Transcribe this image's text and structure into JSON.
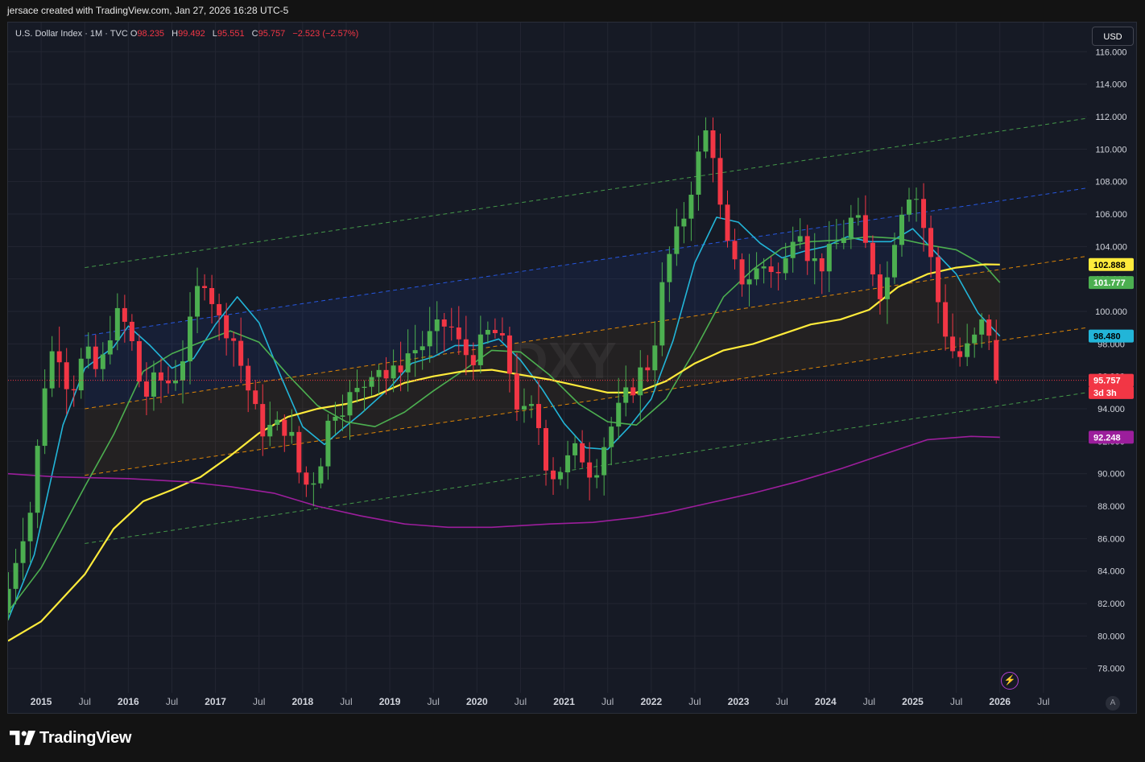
{
  "header": {
    "caption": "jersace created with TradingView.com, Jan 27, 2026 16:28 UTC-5"
  },
  "legend": {
    "symbol": "U.S. Dollar Index · 1M · TVC",
    "o_label": "O",
    "o_value": "98.235",
    "h_label": "H",
    "h_value": "99.492",
    "l_label": "L",
    "l_value": "95.551",
    "c_label": "C",
    "c_value": "95.757",
    "change": "−2.523 (−2.57%)"
  },
  "currency_button": "USD",
  "auto_scale_label": "A",
  "alert_icon": "lightning-bolt-icon",
  "watermark": "DXY",
  "brand": {
    "logo_icon": "tradingview-logo-icon",
    "name": "TradingView"
  },
  "colors": {
    "background": "#161a25",
    "up": "#4caf50",
    "down": "#f23645",
    "sma_short": "#22b5d8",
    "sma_mid": "#4caf50",
    "sma_long": "#ffeb3b",
    "sma_xlong": "#9c1e9c",
    "channel_orange": "#ff9800",
    "channel_blue": "#2962ff",
    "channel_green": "#4caf50"
  },
  "chart_data": {
    "type": "candlestick",
    "interval": "1M",
    "y_axis": {
      "range": [
        76.5,
        117.8
      ],
      "ticks": [
        "116.000",
        "114.000",
        "112.000",
        "110.000",
        "108.000",
        "106.000",
        "104.000",
        "102.000",
        "100.000",
        "98.000",
        "96.000",
        "94.000",
        "92.000",
        "90.000",
        "88.000",
        "86.000",
        "84.000",
        "82.000",
        "80.000",
        "78.000"
      ]
    },
    "x_axis": {
      "range": [
        2014.62,
        2027.0
      ],
      "ticks": [
        {
          "t": 2015.0,
          "label": "2015"
        },
        {
          "t": 2015.5,
          "label": "Jul"
        },
        {
          "t": 2016.0,
          "label": "2016"
        },
        {
          "t": 2016.5,
          "label": "Jul"
        },
        {
          "t": 2017.0,
          "label": "2017"
        },
        {
          "t": 2017.5,
          "label": "Jul"
        },
        {
          "t": 2018.0,
          "label": "2018"
        },
        {
          "t": 2018.5,
          "label": "Jul"
        },
        {
          "t": 2019.0,
          "label": "2019"
        },
        {
          "t": 2019.5,
          "label": "Jul"
        },
        {
          "t": 2020.0,
          "label": "2020"
        },
        {
          "t": 2020.5,
          "label": "Jul"
        },
        {
          "t": 2021.0,
          "label": "2021"
        },
        {
          "t": 2021.5,
          "label": "Jul"
        },
        {
          "t": 2022.0,
          "label": "2022"
        },
        {
          "t": 2022.5,
          "label": "Jul"
        },
        {
          "t": 2023.0,
          "label": "2023"
        },
        {
          "t": 2023.5,
          "label": "Jul"
        },
        {
          "t": 2024.0,
          "label": "2024"
        },
        {
          "t": 2024.5,
          "label": "Jul"
        },
        {
          "t": 2025.0,
          "label": "2025"
        },
        {
          "t": 2025.5,
          "label": "Jul"
        },
        {
          "t": 2026.0,
          "label": "2026"
        },
        {
          "t": 2026.5,
          "label": "Jul"
        }
      ]
    },
    "close_anchors": [
      [
        2014.62,
        82.8
      ],
      [
        2014.75,
        85.9
      ],
      [
        2014.92,
        88.4
      ],
      [
        2015.0,
        94.8
      ],
      [
        2015.17,
        98.4
      ],
      [
        2015.33,
        95.0
      ],
      [
        2015.5,
        97.4
      ],
      [
        2015.67,
        96.0
      ],
      [
        2015.83,
        99.8
      ],
      [
        2016.0,
        99.0
      ],
      [
        2016.17,
        94.6
      ],
      [
        2016.33,
        95.8
      ],
      [
        2016.5,
        95.6
      ],
      [
        2016.67,
        97.9
      ],
      [
        2016.83,
        102.2
      ],
      [
        2016.92,
        102.2
      ],
      [
        2017.0,
        99.5
      ],
      [
        2017.17,
        99.0
      ],
      [
        2017.33,
        96.0
      ],
      [
        2017.5,
        92.9
      ],
      [
        2017.67,
        92.7
      ],
      [
        2017.83,
        93.1
      ],
      [
        2018.0,
        89.1
      ],
      [
        2018.17,
        90.1
      ],
      [
        2018.33,
        94.0
      ],
      [
        2018.5,
        94.5
      ],
      [
        2018.67,
        95.1
      ],
      [
        2018.83,
        97.1
      ],
      [
        2019.0,
        95.6
      ],
      [
        2019.17,
        97.3
      ],
      [
        2019.33,
        97.8
      ],
      [
        2019.5,
        98.5
      ],
      [
        2019.67,
        99.4
      ],
      [
        2019.83,
        97.4
      ],
      [
        2020.0,
        97.4
      ],
      [
        2020.17,
        99.0
      ],
      [
        2020.33,
        97.4
      ],
      [
        2020.5,
        93.4
      ],
      [
        2020.67,
        93.9
      ],
      [
        2020.83,
        89.9
      ],
      [
        2021.0,
        90.5
      ],
      [
        2021.17,
        91.5
      ],
      [
        2021.33,
        90.0
      ],
      [
        2021.5,
        92.5
      ],
      [
        2021.67,
        94.2
      ],
      [
        2021.83,
        95.9
      ],
      [
        2022.0,
        97.0
      ],
      [
        2022.17,
        102.9
      ],
      [
        2022.33,
        105.0
      ],
      [
        2022.5,
        108.7
      ],
      [
        2022.67,
        111.8
      ],
      [
        2022.83,
        104.4
      ],
      [
        2023.0,
        102.0
      ],
      [
        2023.17,
        102.3
      ],
      [
        2023.33,
        103.0
      ],
      [
        2023.5,
        102.0
      ],
      [
        2023.67,
        106.2
      ],
      [
        2023.83,
        103.0
      ],
      [
        2024.0,
        103.0
      ],
      [
        2024.17,
        104.5
      ],
      [
        2024.33,
        105.9
      ],
      [
        2024.5,
        103.3
      ],
      [
        2024.67,
        100.8
      ],
      [
        2024.83,
        106.0
      ],
      [
        2025.0,
        108.0
      ],
      [
        2025.17,
        104.2
      ],
      [
        2025.33,
        99.5
      ],
      [
        2025.5,
        97.0
      ],
      [
        2025.67,
        97.8
      ],
      [
        2025.83,
        99.5
      ],
      [
        2025.92,
        98.2
      ],
      [
        2026.0,
        95.757
      ]
    ],
    "moving_averages": [
      {
        "color": "#22b5d8",
        "points": [
          [
            2014.62,
            81.0
          ],
          [
            2014.92,
            85.0
          ],
          [
            2015.25,
            93.0
          ],
          [
            2015.5,
            96.5
          ],
          [
            2015.83,
            97.8
          ],
          [
            2016.0,
            99.1
          ],
          [
            2016.25,
            97.9
          ],
          [
            2016.5,
            96.5
          ],
          [
            2016.75,
            97.1
          ],
          [
            2017.0,
            99.2
          ],
          [
            2017.25,
            100.9
          ],
          [
            2017.5,
            99.3
          ],
          [
            2017.75,
            96.0
          ],
          [
            2018.0,
            92.9
          ],
          [
            2018.25,
            91.8
          ],
          [
            2018.42,
            92.6
          ],
          [
            2018.67,
            93.7
          ],
          [
            2019.0,
            95.3
          ],
          [
            2019.25,
            96.8
          ],
          [
            2019.5,
            97.2
          ],
          [
            2019.75,
            97.9
          ],
          [
            2020.0,
            97.9
          ],
          [
            2020.25,
            98.3
          ],
          [
            2020.5,
            97.0
          ],
          [
            2020.75,
            95.2
          ],
          [
            2021.0,
            93.1
          ],
          [
            2021.25,
            91.6
          ],
          [
            2021.5,
            91.5
          ],
          [
            2021.75,
            92.9
          ],
          [
            2022.0,
            94.6
          ],
          [
            2022.25,
            98.2
          ],
          [
            2022.5,
            103.0
          ],
          [
            2022.75,
            105.8
          ],
          [
            2023.0,
            105.5
          ],
          [
            2023.25,
            104.2
          ],
          [
            2023.5,
            103.3
          ],
          [
            2023.75,
            103.7
          ],
          [
            2024.0,
            104.0
          ],
          [
            2024.25,
            104.6
          ],
          [
            2024.5,
            104.3
          ],
          [
            2024.75,
            104.3
          ],
          [
            2025.0,
            105.1
          ],
          [
            2025.25,
            103.7
          ],
          [
            2025.5,
            102.3
          ],
          [
            2025.75,
            99.9
          ],
          [
            2026.0,
            98.48
          ]
        ]
      },
      {
        "color": "#4caf50",
        "points": [
          [
            2014.62,
            81.5
          ],
          [
            2015.0,
            84.2
          ],
          [
            2015.5,
            89.2
          ],
          [
            2015.83,
            92.4
          ],
          [
            2016.17,
            96.3
          ],
          [
            2016.5,
            97.4
          ],
          [
            2016.83,
            98.1
          ],
          [
            2017.17,
            98.8
          ],
          [
            2017.5,
            98.1
          ],
          [
            2017.83,
            96.1
          ],
          [
            2018.17,
            94.2
          ],
          [
            2018.5,
            93.2
          ],
          [
            2018.83,
            92.9
          ],
          [
            2019.17,
            93.8
          ],
          [
            2019.5,
            95.1
          ],
          [
            2019.83,
            96.3
          ],
          [
            2020.17,
            97.6
          ],
          [
            2020.5,
            97.5
          ],
          [
            2020.83,
            96.1
          ],
          [
            2021.17,
            94.3
          ],
          [
            2021.5,
            93.2
          ],
          [
            2021.83,
            93.0
          ],
          [
            2022.17,
            94.6
          ],
          [
            2022.5,
            97.6
          ],
          [
            2022.83,
            100.9
          ],
          [
            2023.17,
            102.6
          ],
          [
            2023.5,
            103.9
          ],
          [
            2023.83,
            104.3
          ],
          [
            2024.17,
            104.4
          ],
          [
            2024.5,
            104.6
          ],
          [
            2024.83,
            104.5
          ],
          [
            2025.17,
            104.1
          ],
          [
            2025.5,
            103.8
          ],
          [
            2025.83,
            102.8
          ],
          [
            2026.0,
            101.777
          ]
        ]
      },
      {
        "color": "#ffeb3b",
        "points": [
          [
            2014.62,
            79.7
          ],
          [
            2015.0,
            80.9
          ],
          [
            2015.5,
            83.8
          ],
          [
            2015.83,
            86.6
          ],
          [
            2016.17,
            88.3
          ],
          [
            2016.5,
            89.0
          ],
          [
            2016.83,
            89.8
          ],
          [
            2017.17,
            91.1
          ],
          [
            2017.5,
            92.5
          ],
          [
            2017.83,
            93.5
          ],
          [
            2018.17,
            94.0
          ],
          [
            2018.5,
            94.3
          ],
          [
            2018.83,
            94.8
          ],
          [
            2019.17,
            95.6
          ],
          [
            2019.5,
            96.0
          ],
          [
            2019.83,
            96.3
          ],
          [
            2020.17,
            96.4
          ],
          [
            2020.5,
            96.1
          ],
          [
            2020.83,
            95.8
          ],
          [
            2021.17,
            95.4
          ],
          [
            2021.5,
            95.0
          ],
          [
            2021.83,
            95.0
          ],
          [
            2022.17,
            95.7
          ],
          [
            2022.5,
            96.8
          ],
          [
            2022.83,
            97.6
          ],
          [
            2023.17,
            98.0
          ],
          [
            2023.5,
            98.6
          ],
          [
            2023.83,
            99.2
          ],
          [
            2024.17,
            99.5
          ],
          [
            2024.5,
            100.1
          ],
          [
            2024.83,
            101.5
          ],
          [
            2025.17,
            102.3
          ],
          [
            2025.5,
            102.7
          ],
          [
            2025.83,
            102.9
          ],
          [
            2026.0,
            102.888
          ]
        ]
      },
      {
        "color": "#9c1e9c",
        "points": [
          [
            2014.62,
            90.0
          ],
          [
            2015.17,
            89.8
          ],
          [
            2016.0,
            89.7
          ],
          [
            2016.67,
            89.5
          ],
          [
            2017.17,
            89.2
          ],
          [
            2017.67,
            88.8
          ],
          [
            2018.17,
            88.0
          ],
          [
            2018.67,
            87.4
          ],
          [
            2019.17,
            86.9
          ],
          [
            2019.67,
            86.7
          ],
          [
            2020.17,
            86.7
          ],
          [
            2020.83,
            86.9
          ],
          [
            2021.33,
            87.0
          ],
          [
            2021.83,
            87.3
          ],
          [
            2022.17,
            87.6
          ],
          [
            2022.67,
            88.2
          ],
          [
            2023.17,
            88.8
          ],
          [
            2023.67,
            89.5
          ],
          [
            2024.17,
            90.3
          ],
          [
            2024.67,
            91.2
          ],
          [
            2025.17,
            92.1
          ],
          [
            2025.67,
            92.3
          ],
          [
            2026.0,
            92.248
          ]
        ]
      }
    ],
    "channels": [
      {
        "name": "upper outer",
        "color": "#4caf50",
        "p1": [
          2015.5,
          102.7
        ],
        "p2": [
          2027.0,
          111.9
        ]
      },
      {
        "name": "upper",
        "color": "#2962ff",
        "p1": [
          2015.5,
          98.5
        ],
        "p2": [
          2027.0,
          107.6
        ]
      },
      {
        "name": "mid upper",
        "color": "#ff9800",
        "p1": [
          2015.5,
          94.0
        ],
        "p2": [
          2027.0,
          103.4
        ]
      },
      {
        "name": "mid lower",
        "color": "#ff9800",
        "p1": [
          2015.5,
          89.9
        ],
        "p2": [
          2027.0,
          99.0
        ]
      },
      {
        "name": "lower outer",
        "color": "#4caf50",
        "p1": [
          2015.5,
          85.7
        ],
        "p2": [
          2027.0,
          95.0
        ]
      }
    ],
    "price_labels": [
      {
        "value": "102.888",
        "bg": "#ffeb3b",
        "fg": "#000000",
        "y": 102.888
      },
      {
        "value": "101.777",
        "bg": "#4caf50",
        "fg": "#ffffff",
        "y": 101.777
      },
      {
        "value": "98.480",
        "bg": "#22b5d8",
        "fg": "#000000",
        "y": 98.48
      },
      {
        "value": "95.757",
        "bg": "#f23645",
        "fg": "#ffffff",
        "y": 95.757
      },
      {
        "value": "3d 3h",
        "bg": "#f23645",
        "fg": "#ffffff",
        "y": 95.0
      },
      {
        "value": "92.248",
        "bg": "#9c1e9c",
        "fg": "#ffffff",
        "y": 92.248
      }
    ]
  }
}
